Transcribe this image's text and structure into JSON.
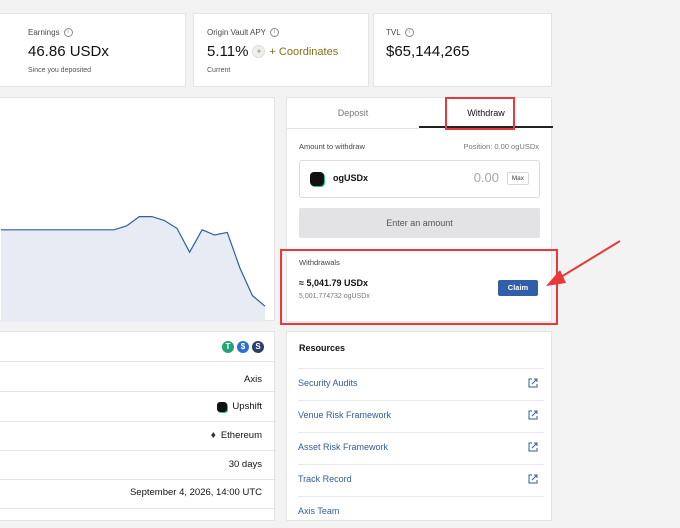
{
  "stats": {
    "earnings": {
      "label": "Earnings",
      "value": "46.86 USDx",
      "sub": "Since you deposited"
    },
    "apy": {
      "label": "Origin Vault APY",
      "value": "5.11%",
      "coordinates": "+ Coordinates",
      "sub": "Current"
    },
    "tvl": {
      "label": "TVL",
      "value": "$65,144,265"
    }
  },
  "chart_data": {
    "type": "area",
    "title": "",
    "xlabel": "",
    "ylabel": "",
    "values": [
      5.0,
      5.0,
      5.0,
      5.0,
      5.0,
      5.0,
      5.0,
      5.0,
      5.0,
      5.0,
      5.3,
      6.0,
      6.0,
      5.7,
      5.1,
      3.3,
      5.0,
      4.6,
      4.8,
      2.1,
      0.0,
      -0.8
    ],
    "ylim": [
      -2,
      15
    ],
    "color": "#2f5fa8",
    "fill": "#e7ebf3"
  },
  "details": {
    "rows": [
      "Axis",
      "Upshift",
      "Ethereum",
      "30 days",
      "September 4, 2026, 14:00 UTC"
    ],
    "badge_icons": [
      "tether-icon",
      "usdc-icon",
      "sky-icon"
    ]
  },
  "panel": {
    "tabs": [
      "Deposit",
      "Withdraw"
    ],
    "active_tab": "Withdraw",
    "amount_label": "Amount to withdraw",
    "position": "Position: 0.00 ogUSDx",
    "token": "ogUSDx",
    "amount_placeholder": "0.00",
    "max_label": "Max",
    "submit_label": "Enter an amount",
    "withdrawals": {
      "title": "Withdrawals",
      "amount": "≈ 5,041.79 USDx",
      "sub": "5,001.774732 ogUSDx",
      "claim_label": "Claim"
    }
  },
  "resources": {
    "title": "Resources",
    "items": [
      "Security Audits",
      "Venue Risk Framework",
      "Asset Risk Framework",
      "Track Record",
      "Axis Team"
    ]
  },
  "colors": {
    "accent": "#2f5fa8",
    "annotation": "#e8393a",
    "coordinates_gold": "#8a6d1a"
  }
}
